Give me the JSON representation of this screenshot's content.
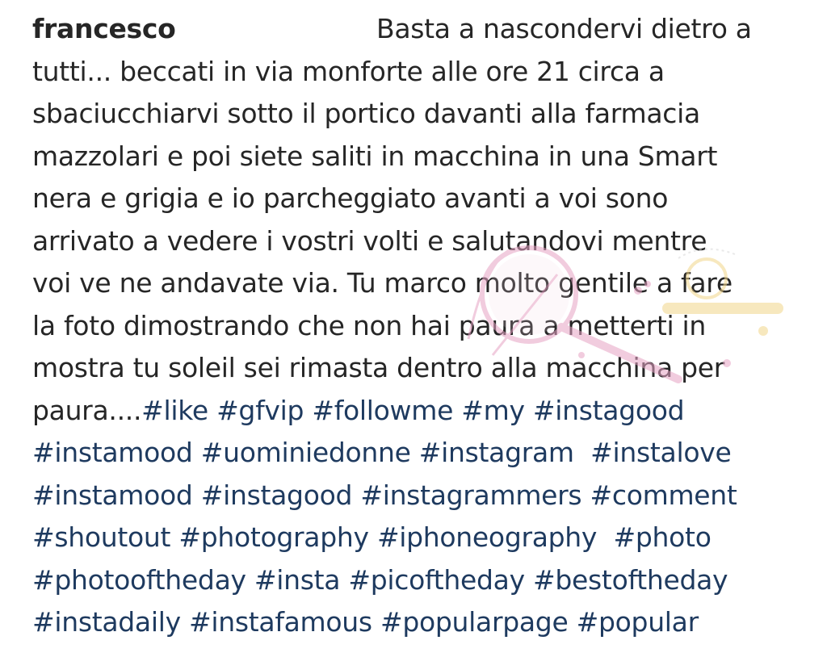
{
  "comment": {
    "username": "francesco",
    "lines": [
      "Basta a nascondervi dietro a",
      "tutti... beccati in via monforte alle ore 21 circa a",
      "sbaciucchiarvi sotto il portico davanti alla farmacia",
      "mazzolari e poi siete saliti in macchina in una Smart",
      "nera e grigia e io parcheggiato avanti a voi sono",
      "arrivato a vedere i vostri volti e salutandovi mentre",
      "voi ve ne andavate via. Tu marco molto gentile a fare",
      "la foto dimostrando che non hai paura a metterti in",
      "mostra tu soleil sei rimasta dentro alla macchina per"
    ],
    "text_end": "paura....",
    "hashtag_lines": [
      [
        "#like",
        "#gfvip",
        "#followme",
        "#my",
        "#instagood"
      ],
      [
        "#instamood",
        "#uominiedonne",
        "#instagram",
        "#instalove"
      ],
      [
        "#instamood",
        "#instagood",
        "#instagrammers",
        "#comment"
      ],
      [
        "#shoutout",
        "#photography",
        "#iphoneography",
        "#photo"
      ],
      [
        "#photooftheday",
        "#insta",
        "#picoftheday",
        "#bestoftheday"
      ],
      [
        "#instadaily",
        "#instafamous",
        "#popularpage",
        "#popular"
      ]
    ]
  },
  "colors": {
    "text": "#262626",
    "hashtag": "#1e3a5f",
    "watermark": "#e7a3c4"
  }
}
